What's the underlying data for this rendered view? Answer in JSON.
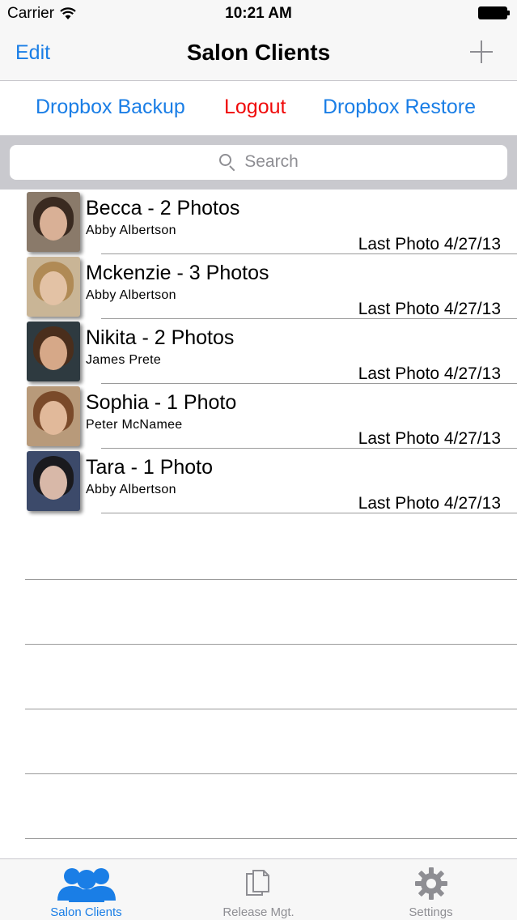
{
  "status": {
    "carrier": "Carrier",
    "time": "10:21 AM"
  },
  "nav": {
    "edit": "Edit",
    "title": "Salon Clients",
    "add_icon": "plus-icon"
  },
  "toolbar": {
    "backup": "Dropbox Backup",
    "logout": "Logout",
    "restore": "Dropbox Restore"
  },
  "search": {
    "placeholder": "Search"
  },
  "clients": [
    {
      "name": "Becca - 2 Photos",
      "stylist": "Abby Albertson",
      "last": "Last Photo 4/27/13",
      "hair": "#3a2a20",
      "face": "#d9b096",
      "bg": "#8a7a6a"
    },
    {
      "name": "Mckenzie - 3 Photos",
      "stylist": "Abby Albertson",
      "last": "Last Photo 4/27/13",
      "hair": "#b08a55",
      "face": "#e3c2a5",
      "bg": "#c9b596"
    },
    {
      "name": "Nikita - 2 Photos",
      "stylist": "James Prete",
      "last": "Last Photo 4/27/13",
      "hair": "#4a2e1c",
      "face": "#d6a888",
      "bg": "#2e3a40"
    },
    {
      "name": "Sophia - 1 Photo",
      "stylist": "Peter McNamee",
      "last": "Last Photo 4/27/13",
      "hair": "#7a4a2a",
      "face": "#e1b99a",
      "bg": "#b89a7a"
    },
    {
      "name": "Tara - 1 Photo",
      "stylist": "Abby Albertson",
      "last": "Last Photo 4/27/13",
      "hair": "#1a1a1e",
      "face": "#d8b8a8",
      "bg": "#3c4a6a"
    }
  ],
  "tabs": [
    {
      "label": "Salon Clients",
      "icon": "people-icon",
      "active": true
    },
    {
      "label": "Release Mgt.",
      "icon": "documents-icon",
      "active": false
    },
    {
      "label": "Settings",
      "icon": "gear-icon",
      "active": false
    }
  ],
  "colors": {
    "accent": "#1a7ee6",
    "logout": "#f00a0a",
    "inactive": "#8e8e93"
  }
}
